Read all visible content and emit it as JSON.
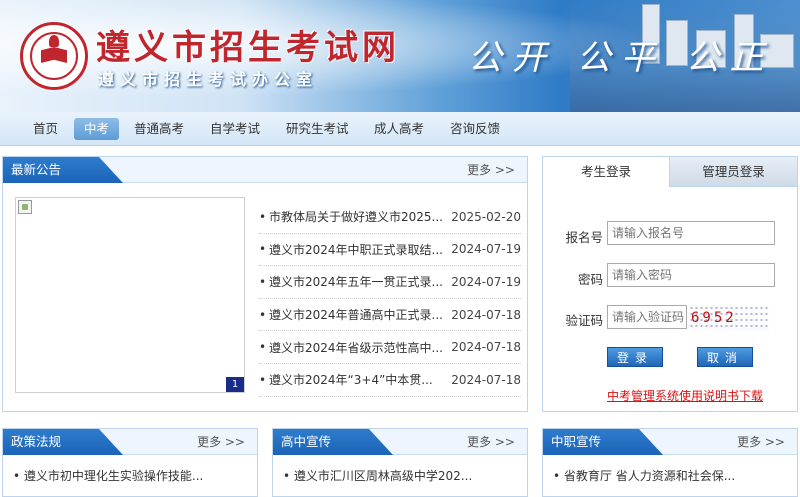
{
  "header": {
    "title": "遵义市招生考试网",
    "subtitle": "遵义市招生考试办公室",
    "slogan": "公开 公平 公正"
  },
  "nav": {
    "items": [
      {
        "label": "首页",
        "active": false
      },
      {
        "label": "中考",
        "active": true
      },
      {
        "label": "普通高考",
        "active": false
      },
      {
        "label": "自学考试",
        "active": false
      },
      {
        "label": "研究生考试",
        "active": false
      },
      {
        "label": "成人高考",
        "active": false
      },
      {
        "label": "咨询反馈",
        "active": false
      }
    ]
  },
  "announcements": {
    "title": "最新公告",
    "more": "更多 >>",
    "slide_number": "1",
    "items": [
      {
        "title": "市教体局关于做好遵义市2025...",
        "date": "2025-02-20"
      },
      {
        "title": "遵义市2024年中职正式录取结...",
        "date": "2024-07-19"
      },
      {
        "title": "遵义市2024年五年一贯正式录...",
        "date": "2024-07-19"
      },
      {
        "title": "遵义市2024年普通高中正式录...",
        "date": "2024-07-18"
      },
      {
        "title": "遵义市2024年省级示范性高中...",
        "date": "2024-07-18"
      },
      {
        "title": "遵义市2024年“3+4”中本贯...",
        "date": "2024-07-18"
      }
    ]
  },
  "login": {
    "tab_student": "考生登录",
    "tab_admin": "管理员登录",
    "reg_label": "报名号",
    "reg_placeholder": "请输入报名号",
    "pwd_label": "密码",
    "pwd_placeholder": "请输入密码",
    "code_label": "验证码",
    "code_placeholder": "请输入验证码",
    "captcha_text": "6952",
    "login_button": "登录",
    "cancel_button": "取消",
    "manual_link": "中考管理系统使用说明书下载"
  },
  "bottom_panels": [
    {
      "title": "政策法规",
      "more": "更多 >>",
      "first_item": "遵义市初中理化生实验操作技能..."
    },
    {
      "title": "高中宣传",
      "more": "更多 >>",
      "first_item": "遵义市汇川区周林高级中学202..."
    },
    {
      "title": "中职宣传",
      "more": "更多 >>",
      "first_item": "省教育厅 省人力资源和社会保..."
    }
  ]
}
